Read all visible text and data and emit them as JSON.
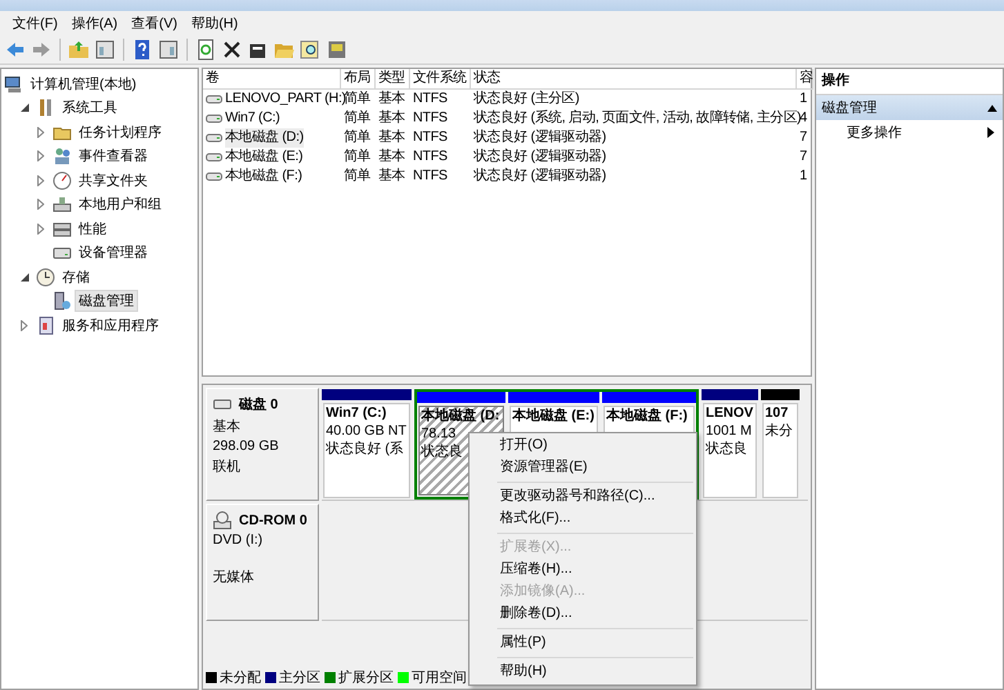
{
  "menu_bar": [
    "文件(F)",
    "操作(A)",
    "查看(V)",
    "帮助(H)"
  ],
  "tree": [
    {
      "label": "计算机管理(本地)",
      "children": [
        {
          "label": "系统工具",
          "expanded": true,
          "selected": false,
          "children": [
            {
              "label": "任务计划程序",
              "expanded": false,
              "selected": false
            },
            {
              "label": "事件查看器",
              "expanded": false,
              "selected": false
            },
            {
              "label": "共享文件夹",
              "expanded": false,
              "selected": false
            },
            {
              "label": "本地用户和组",
              "expanded": false,
              "selected": false
            },
            {
              "label": "性能",
              "expanded": false,
              "selected": false
            },
            {
              "label": "设备管理器",
              "selected": false
            }
          ]
        },
        {
          "label": "存储",
          "expanded": true,
          "selected": false,
          "children": [
            {
              "label": "磁盘管理",
              "selected": true
            }
          ]
        },
        {
          "label": "服务和应用程序",
          "expanded": false,
          "selected": false
        }
      ]
    }
  ],
  "volumes": {
    "columns": [
      "卷",
      "布局",
      "类型",
      "文件系统",
      "状态",
      "容"
    ],
    "rows": [
      {
        "cells": [
          "LENOVO_PART (H:)",
          "简单",
          "基本",
          "NTFS",
          "状态良好 (主分区)",
          "1"
        ],
        "selected": false
      },
      {
        "cells": [
          "Win7 (C:)",
          "简单",
          "基本",
          "NTFS",
          "状态良好 (系统, 启动, 页面文件, 活动, 故障转储, 主分区)",
          "4"
        ],
        "selected": false
      },
      {
        "cells": [
          "本地磁盘 (D:)",
          "简单",
          "基本",
          "NTFS",
          "状态良好 (逻辑驱动器)",
          "7"
        ],
        "selected": true
      },
      {
        "cells": [
          "本地磁盘 (E:)",
          "简单",
          "基本",
          "NTFS",
          "状态良好 (逻辑驱动器)",
          "7"
        ],
        "selected": false
      },
      {
        "cells": [
          "本地磁盘 (F:)",
          "简单",
          "基本",
          "NTFS",
          "状态良好 (逻辑驱动器)",
          "1"
        ],
        "selected": false
      }
    ]
  },
  "disks": [
    {
      "kind": "hdd",
      "name": "磁盘 0",
      "lines": [
        "基本",
        "298.09 GB",
        "联机"
      ],
      "partitions": [
        {
          "kind": "primary",
          "selected": false,
          "lines": [
            "Win7  (C:)",
            "40.00 GB NT",
            "状态良好 (系"
          ]
        },
        {
          "kind": "extended",
          "children": [
            {
              "kind": "logical",
              "selected": true,
              "lines": [
                "本地磁盘 (D:",
                "78.13",
                "状态良"
              ]
            },
            {
              "kind": "logical",
              "selected": false,
              "lines": [
                "本地磁盘 (E:)"
              ]
            },
            {
              "kind": "logical",
              "selected": false,
              "lines": [
                "本地磁盘 (F:)"
              ]
            }
          ]
        },
        {
          "kind": "primary",
          "selected": false,
          "lines": [
            "LENOV",
            "1001 M",
            "状态良"
          ]
        },
        {
          "kind": "unallocated",
          "selected": false,
          "lines": [
            "107",
            "未分"
          ]
        }
      ]
    },
    {
      "kind": "cdrom",
      "name": "CD-ROM 0",
      "lines": [
        "DVD (I:)",
        "无媒体"
      ]
    }
  ],
  "legend": [
    {
      "label": "未分配",
      "color": "#000000"
    },
    {
      "label": "主分区",
      "color": "#000080"
    },
    {
      "label": "扩展分区",
      "color": "#008000"
    },
    {
      "label": "可用空间",
      "color": "#00ff00"
    }
  ],
  "actions": {
    "title": "操作",
    "sections": [
      {
        "label": "磁盘管理",
        "expanded": true,
        "items": [
          "更多操作"
        ]
      }
    ]
  },
  "context_menu": [
    {
      "kind": "item",
      "label": "打开(O)",
      "disabled": false
    },
    {
      "kind": "item",
      "label": "资源管理器(E)",
      "disabled": false
    },
    {
      "kind": "separator"
    },
    {
      "kind": "item",
      "label": "更改驱动器号和路径(C)...",
      "disabled": false
    },
    {
      "kind": "item",
      "label": "格式化(F)...",
      "disabled": false
    },
    {
      "kind": "separator"
    },
    {
      "kind": "item",
      "label": "扩展卷(X)...",
      "disabled": true
    },
    {
      "kind": "item",
      "label": "压缩卷(H)...",
      "disabled": false
    },
    {
      "kind": "item",
      "label": "添加镜像(A)...",
      "disabled": true
    },
    {
      "kind": "item",
      "label": "删除卷(D)...",
      "disabled": false
    },
    {
      "kind": "separator"
    },
    {
      "kind": "item",
      "label": "属性(P)",
      "disabled": false
    },
    {
      "kind": "separator"
    },
    {
      "kind": "item",
      "label": "帮助(H)",
      "disabled": false
    }
  ]
}
